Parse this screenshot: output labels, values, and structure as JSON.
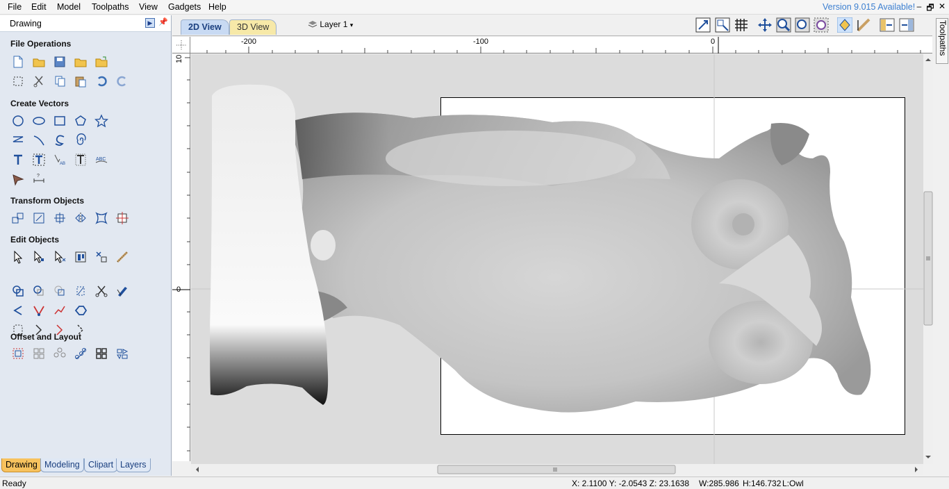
{
  "menu": [
    "File",
    "Edit",
    "Model",
    "Toolpaths",
    "View",
    "Gadgets",
    "Help"
  ],
  "version_notice": "Version 9.015 Available!",
  "window_controls": {
    "minimize": "–",
    "restore": "🗗",
    "close": "✕"
  },
  "left_panel": {
    "title": "Drawing",
    "sections": {
      "file_ops": "File Operations",
      "create_vectors": "Create Vectors",
      "transform": "Transform Objects",
      "edit": "Edit Objects",
      "offset": "Offset and Layout"
    },
    "bottom_tabs": [
      "Drawing",
      "Modeling",
      "Clipart",
      "Layers"
    ]
  },
  "view_tabs": {
    "tab_2d": "2D View",
    "tab_3d": "3D View"
  },
  "layer": {
    "current": "Layer 1"
  },
  "ruler": {
    "h_labels": [
      "-200",
      "-100",
      "0"
    ],
    "v_labels": [
      "10",
      "0"
    ]
  },
  "right_panel": {
    "label": "Toolpaths"
  },
  "status": {
    "ready": "Ready",
    "coords": "X:  2.1100 Y: -2.0543 Z: 23.1638",
    "width": "W:285.986",
    "height": "H:146.732",
    "layer": "L:Owl"
  },
  "colors": {
    "panel_bg": "#e2e8f1",
    "active_tab": "#f7c25e",
    "canvas_bg": "#dcdcdc"
  }
}
